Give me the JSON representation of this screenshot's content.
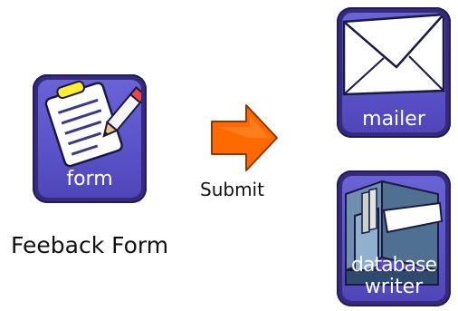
{
  "form_icon": {
    "label": "form",
    "caption": "Feeback Form"
  },
  "submit": {
    "label": "Submit"
  },
  "mailer_icon": {
    "label": "mailer"
  },
  "database_icon": {
    "label_line1": "database",
    "label_line2": "writer"
  },
  "colors": {
    "tile_border": "#352a7c",
    "tile_fill": "#5a52c8",
    "arrow": "#ff6a00",
    "arrow_edge": "#8a3a00"
  }
}
